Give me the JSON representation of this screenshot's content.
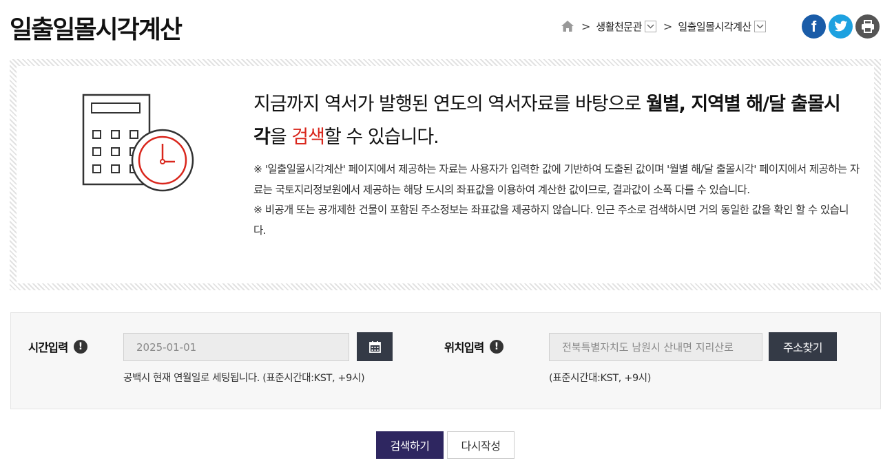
{
  "header": {
    "title": "일출일몰시각계산"
  },
  "breadcrumb": {
    "home_icon": "home-icon",
    "items": [
      {
        "label": "생활천문관"
      },
      {
        "label": "일출일몰시각계산"
      }
    ]
  },
  "social": {
    "facebook_label": "f",
    "facebook_color": "#1a5ca8",
    "twitter_color": "#1da1e0",
    "print_color": "#555555"
  },
  "intro": {
    "illustration_icon": "calculator-clock-icon",
    "headline": {
      "part1": "지금까지 역서가 발행된 연도의 역서자료를 바탕으로 ",
      "bold1": "월별, 지역별 해/달 출몰시각",
      "part2": "을 ",
      "red": "검색",
      "part3": "할 수 있습니다."
    },
    "notes": [
      "※ '일출일몰시각계산' 페이지에서 제공하는 자료는 사용자가 입력한 값에 기반하여 도출된 값이며 '월별 해/달 출몰시각' 페이지에서 제공하는 자료는 국토지리정보원에서 제공하는 해당 도시의 좌표값을 이용하여 계산한 값이므로, 결과값이 소폭 다를 수 있습니다.",
      "※ 비공개 또는 공개제한 건물이 포함된 주소정보는 좌표값을 제공하지 않습니다. 인근 주소로 검색하시면 거의 동일한 값을 확인 할 수 있습니다."
    ]
  },
  "search": {
    "time": {
      "label": "시간입력",
      "info": "!",
      "value": "2025-01-01",
      "hint": "공백시 현재 연월일로 세팅됩니다. (표준시간대:KST, +9시)"
    },
    "location": {
      "label": "위치입력",
      "info": "!",
      "value": "전북특별자치도 남원시 산내면 지리산로",
      "button": "주소찾기",
      "hint": "(표준시간대:KST, +9시)"
    }
  },
  "actions": {
    "search": "검색하기",
    "reset": "다시작성"
  }
}
